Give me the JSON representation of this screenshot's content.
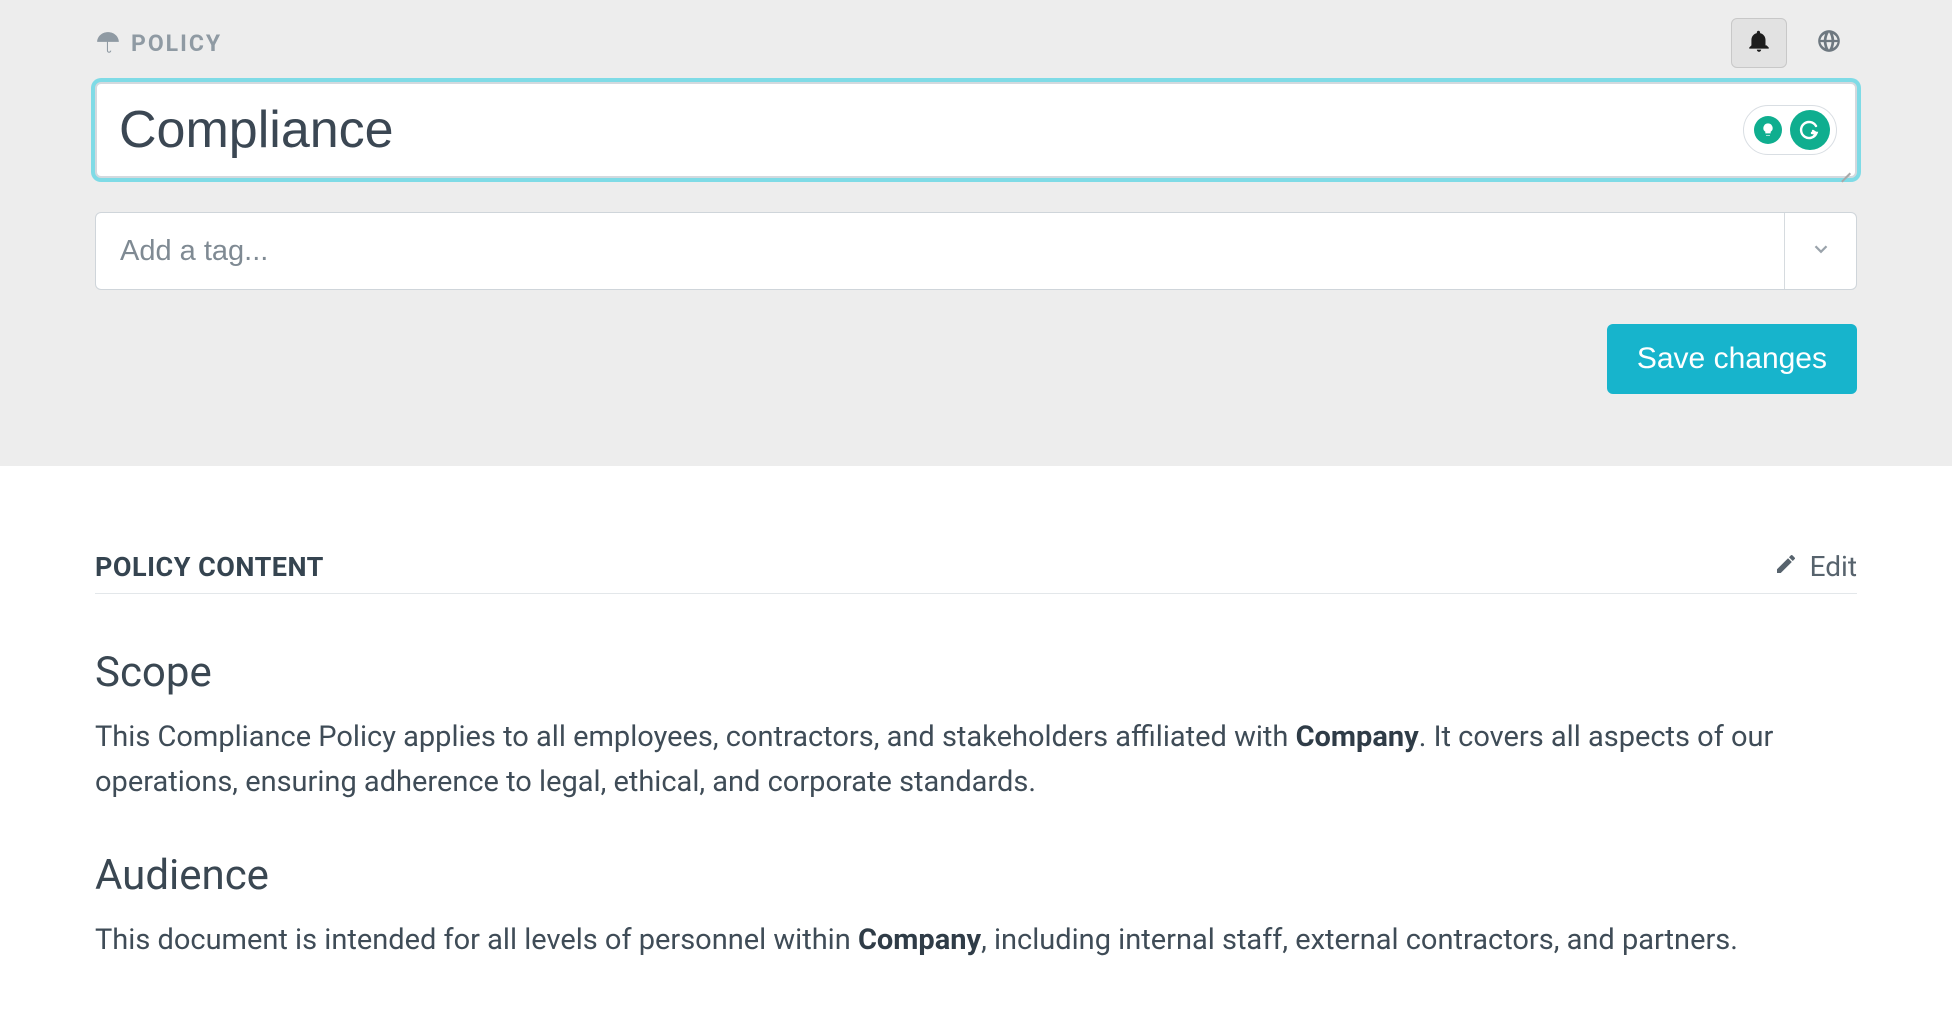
{
  "header": {
    "policy_label": "POLICY",
    "title_value": "Compliance",
    "tag_placeholder": "Add a tag...",
    "save_label": "Save changes"
  },
  "content": {
    "section_title": "POLICY CONTENT",
    "edit_label": "Edit",
    "scope_heading": "Scope",
    "scope_p_pre": "This Compliance Policy applies to all employees, contractors, and stakeholders affiliated with ",
    "scope_p_bold": "Company",
    "scope_p_post": ". It covers all aspects of our operations, ensuring adherence to legal, ethical, and corporate standards.",
    "audience_heading": "Audience",
    "audience_p_pre": "This document is intended for all levels of personnel within ",
    "audience_p_bold": "Company",
    "audience_p_post": ", including internal staff, external contractors, and partners."
  }
}
